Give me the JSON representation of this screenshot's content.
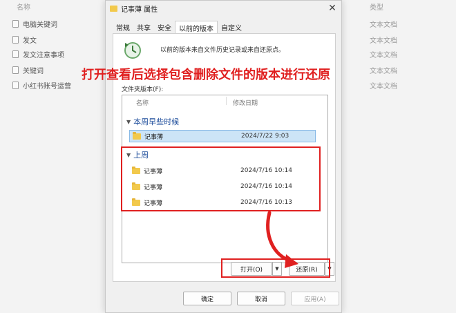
{
  "background": {
    "name_header": "名称",
    "type_header": "类型",
    "files": [
      {
        "name": "电脑关键词",
        "type": "文本文档"
      },
      {
        "name": "发文",
        "type": "文本文档"
      },
      {
        "name": "发文注意事项",
        "type": "文本文档"
      },
      {
        "name": "关键词",
        "type": "文本文档"
      },
      {
        "name": "小红书账号运营",
        "type": "文本文档"
      }
    ]
  },
  "dialog": {
    "title": "记事薄 属性",
    "tabs": [
      "常规",
      "共享",
      "安全",
      "以前的版本",
      "自定义"
    ],
    "active_tab": "以前的版本",
    "info_text": "以前的版本来自文件历史记录或来自还原点。",
    "list_label": "文件夹版本(F):",
    "columns": {
      "name": "名称",
      "date": "修改日期"
    },
    "groups": [
      {
        "label": "本周早些时候",
        "items": [
          {
            "name": "记事薄",
            "date": "2024/7/22 9:03"
          }
        ]
      },
      {
        "label": "上周",
        "items": [
          {
            "name": "记事薄",
            "date": "2024/7/16 10:14"
          },
          {
            "name": "记事薄",
            "date": "2024/7/16 10:14"
          },
          {
            "name": "记事薄",
            "date": "2024/7/16 10:13"
          }
        ]
      }
    ],
    "open_button": "打开(O)",
    "restore_button": "还原(R)",
    "ok_button": "确定",
    "cancel_button": "取消",
    "apply_button": "应用(A)"
  },
  "annotation": "打开查看后选择包含删除文件的版本进行还原",
  "colors": {
    "annotation": "#e02020",
    "selection": "#cce4f7",
    "group_text": "#1f4e9c"
  }
}
